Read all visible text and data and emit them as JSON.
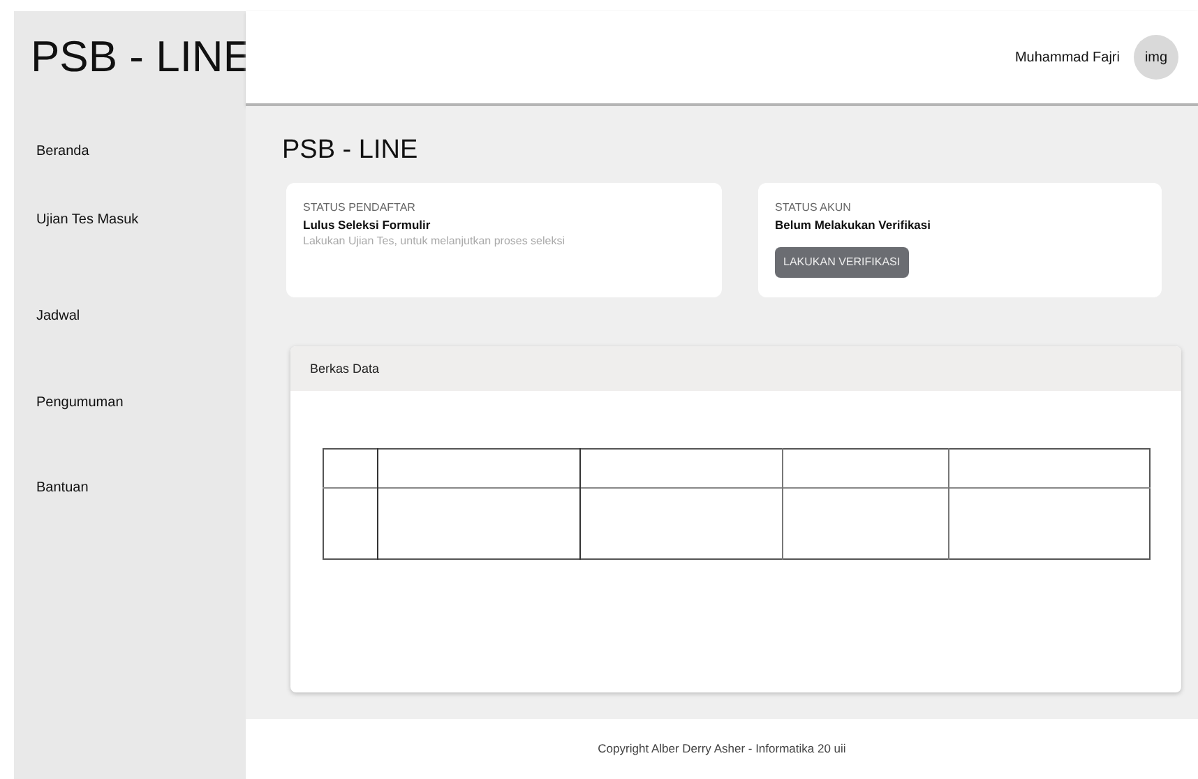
{
  "sidebar": {
    "logo": "PSB - LINE",
    "items": [
      {
        "label": "Beranda"
      },
      {
        "label": "Ujian Tes Masuk"
      },
      {
        "label": "Jadwal"
      },
      {
        "label": "Pengumuman"
      },
      {
        "label": "Bantuan"
      }
    ]
  },
  "header": {
    "user_name": "Muhammad Fajri",
    "avatar": "img"
  },
  "page_title": "PSB - LINE",
  "status_cards": [
    {
      "heading": "STATUS PENDAFTAR",
      "status": "Lulus Seleksi Formulir",
      "note": "Lakukan Ujian Tes, untuk melanjutkan proses seleksi"
    },
    {
      "heading": "STATUS AKUN",
      "status": "Belum Melakukan Verifikasi",
      "button": "LAKUKAN VERIFIKASI"
    }
  ],
  "files_card": {
    "title": "Berkas Data"
  },
  "footer": "Copyright Alber Derry Asher - Informatika 20 uii"
}
